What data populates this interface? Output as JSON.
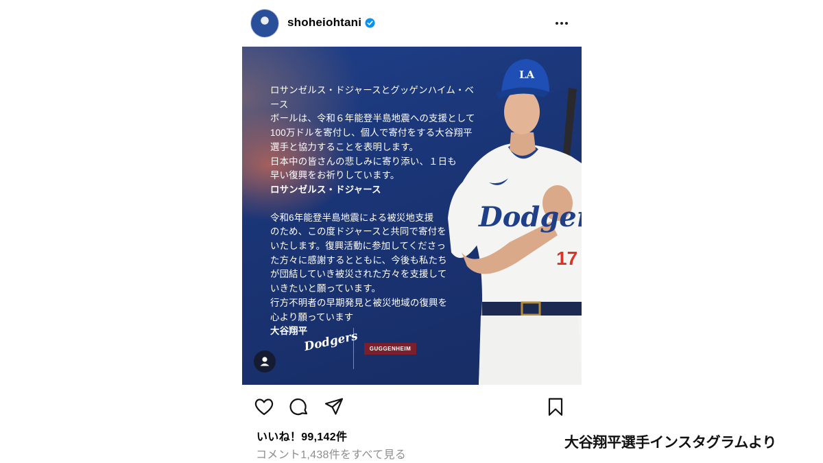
{
  "post_header": {
    "username": "shoheiohtani",
    "avatar_icon": "avatar",
    "verified_icon": "verified-badge-icon",
    "more_icon": "more-options-icon"
  },
  "post_image": {
    "statement_dodgers": [
      "ロサンゼルス・ドジャースとグッゲンハイム・ベース",
      "ボールは、令和６年能登半島地震への支援として",
      "100万ドルを寄付し、個人で寄付をする大谷翔平",
      "選手と協力することを表明します。",
      "日本中の皆さんの悲しみに寄り添い、１日も",
      "早い復興をお祈りしています。"
    ],
    "signature_dodgers": "ロサンゼルス・ドジャース",
    "statement_ohtani": [
      "令和6年能登半島地震による被災地支援",
      "のため、この度ドジャースと共同で寄付を",
      "いたします。復興活動に参加してくださっ",
      "た方々に感謝するとともに、今後も私たち",
      "が団結していき被災された方々を支援して",
      "いきたいと願っています。",
      "行方不明者の早期発見と被災地域の復興を",
      "心より願っています"
    ],
    "signature_ohtani": "大谷翔平",
    "dodgers_logo_text": "Dodgers",
    "guggenheim_logo_text": "GUGGENHEIM",
    "jersey_text": "Dodgers",
    "jersey_number": "17",
    "cap_logo": "LA",
    "colors": {
      "background": "#1c3675",
      "accent": "#e8542f"
    }
  },
  "actions": {
    "like_icon": "heart-icon",
    "comment_icon": "comment-icon",
    "share_icon": "share-icon",
    "save_icon": "bookmark-icon"
  },
  "stats": {
    "likes": "いいね！99,142件",
    "comments_link": "コメント1,438件をすべて見る"
  },
  "caption": "大谷翔平選手インスタグラムより"
}
